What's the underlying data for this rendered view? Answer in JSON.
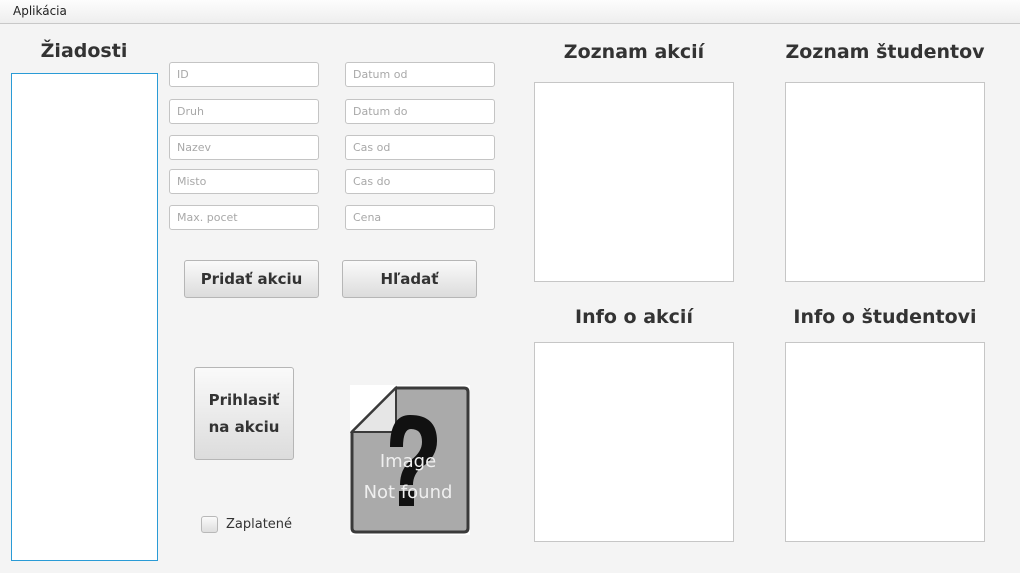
{
  "menubar": {
    "item": "Aplikácia"
  },
  "requests": {
    "heading": "Žiadosti"
  },
  "form": {
    "fields_left": [
      {
        "name": "id-field",
        "placeholder": "ID"
      },
      {
        "name": "druh-field",
        "placeholder": "Druh"
      },
      {
        "name": "nazev-field",
        "placeholder": "Nazev"
      },
      {
        "name": "misto-field",
        "placeholder": "Misto"
      },
      {
        "name": "max-pocet-field",
        "placeholder": "Max. pocet"
      }
    ],
    "fields_right": [
      {
        "name": "datum-od-field",
        "placeholder": "Datum od"
      },
      {
        "name": "datum-do-field",
        "placeholder": "Datum do"
      },
      {
        "name": "cas-od-field",
        "placeholder": "Cas od"
      },
      {
        "name": "cas-do-field",
        "placeholder": "Cas do"
      },
      {
        "name": "cena-field",
        "placeholder": "Cena"
      }
    ],
    "add_label": "Pridať akciu",
    "search_label": "Hľadať",
    "register_label_line1": "Prihlasiť",
    "register_label_line2": "na akciu",
    "paid_label": "Zaplatené",
    "paid_checked": false
  },
  "image_placeholder": {
    "icon": "image-not-found-icon",
    "line1": "Image",
    "line2": "Not found"
  },
  "panels": {
    "events_heading": "Zoznam akcií",
    "students_heading": "Zoznam študentov",
    "event_info_heading": "Info o akcií",
    "student_info_heading": "Info o študentovi"
  }
}
